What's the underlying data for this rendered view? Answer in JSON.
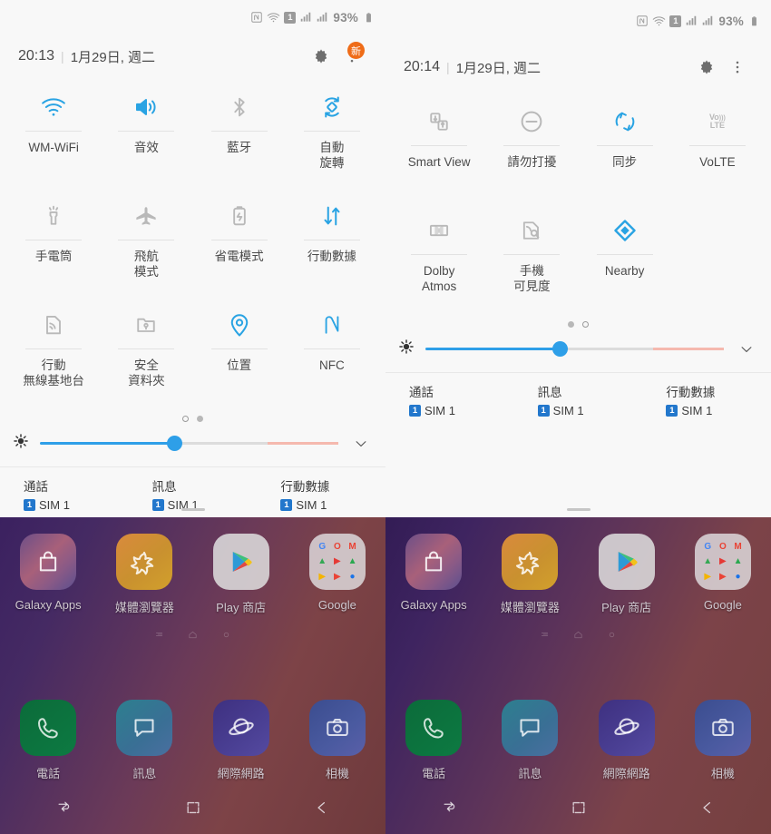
{
  "panels": [
    {
      "id": "left",
      "statusbar": {
        "icons": [
          "nfc-icon",
          "wifi-icon",
          "sim-badge",
          "signal-icon",
          "signal-icon"
        ],
        "sim_label": "1",
        "battery_percent": "93%"
      },
      "header": {
        "time": "20:13",
        "separator": "|",
        "date": "1月29日, 週二",
        "settings_icon": "gear-icon",
        "menu_icon": "more-vertical-icon",
        "badge": "新",
        "badge_color": "#ef6c18"
      },
      "tiles": [
        {
          "icon": "wifi-icon",
          "label": "WM-WiFi",
          "active": true
        },
        {
          "icon": "sound-icon",
          "label": "音效",
          "active": true
        },
        {
          "icon": "bluetooth-icon",
          "label": "藍牙",
          "active": false
        },
        {
          "icon": "auto-rotate-icon",
          "label": "自動\n旋轉",
          "active": true
        },
        {
          "icon": "flashlight-icon",
          "label": "手電筒",
          "active": false
        },
        {
          "icon": "airplane-icon",
          "label": "飛航\n模式",
          "active": false
        },
        {
          "icon": "power-save-icon",
          "label": "省電模式",
          "active": false
        },
        {
          "icon": "mobile-data-icon",
          "label": "行動數據",
          "active": true
        },
        {
          "icon": "hotspot-icon",
          "label": "行動\n無線基地台",
          "active": false
        },
        {
          "icon": "secure-folder-icon",
          "label": "安全\n資料夾",
          "active": false
        },
        {
          "icon": "location-icon",
          "label": "位置",
          "active": true
        },
        {
          "icon": "nfc-icon",
          "label": "NFC",
          "active": true
        }
      ],
      "page_dots": [
        true,
        false
      ],
      "brightness": {
        "icon": "brightness-icon",
        "value": 45,
        "expand_icon": "chevron-down-icon"
      },
      "sims": [
        {
          "title": "通話",
          "badge": "1",
          "name": "SIM 1"
        },
        {
          "title": "訊息",
          "badge": "1",
          "name": "SIM 1"
        },
        {
          "title": "行動數據",
          "badge": "1",
          "name": "SIM 1"
        }
      ],
      "home": {
        "apps": [
          {
            "icon": "galaxy-apps-icon",
            "label": "Galaxy Apps"
          },
          {
            "icon": "media-browser-icon",
            "label": "媒體瀏覽器"
          },
          {
            "icon": "play-store-icon",
            "label": "Play 商店"
          },
          {
            "icon": "google-folder-icon",
            "label": "Google"
          }
        ],
        "dock": [
          {
            "icon": "phone-icon",
            "label": "電話"
          },
          {
            "icon": "messages-icon",
            "label": "訊息"
          },
          {
            "icon": "internet-icon",
            "label": "網際網路"
          },
          {
            "icon": "camera-icon",
            "label": "相機"
          }
        ],
        "nav": [
          "recents-icon",
          "home-icon",
          "back-icon"
        ]
      }
    },
    {
      "id": "right",
      "statusbar": {
        "icons": [
          "nfc-icon",
          "wifi-icon",
          "sim-badge",
          "signal-icon",
          "signal-icon"
        ],
        "sim_label": "1",
        "battery_percent": "93%"
      },
      "header": {
        "time": "20:14",
        "separator": "|",
        "date": "1月29日, 週二",
        "settings_icon": "gear-icon",
        "menu_icon": "more-vertical-icon",
        "badge": "",
        "badge_color": "#ef6c18"
      },
      "tiles": [
        {
          "icon": "smart-view-icon",
          "label": "Smart View",
          "active": false
        },
        {
          "icon": "do-not-disturb-icon",
          "label": "請勿打擾",
          "active": false
        },
        {
          "icon": "sync-icon",
          "label": "同步",
          "active": true
        },
        {
          "icon": "volte-icon",
          "label": "VoLTE",
          "active": false
        },
        {
          "icon": "dolby-atmos-icon",
          "label": "Dolby\nAtmos",
          "active": false
        },
        {
          "icon": "phone-visibility-icon",
          "label": "手機\n可見度",
          "active": false
        },
        {
          "icon": "nearby-icon",
          "label": "Nearby",
          "active": true
        },
        {
          "icon": "",
          "label": "",
          "active": false
        }
      ],
      "page_dots": [
        false,
        true
      ],
      "brightness": {
        "icon": "brightness-icon",
        "value": 45,
        "expand_icon": "chevron-down-icon"
      },
      "sims": [
        {
          "title": "通話",
          "badge": "1",
          "name": "SIM 1"
        },
        {
          "title": "訊息",
          "badge": "1",
          "name": "SIM 1"
        },
        {
          "title": "行動數據",
          "badge": "1",
          "name": "SIM 1"
        }
      ],
      "home": {
        "apps": [
          {
            "icon": "galaxy-apps-icon",
            "label": "Galaxy Apps"
          },
          {
            "icon": "media-browser-icon",
            "label": "媒體瀏覽器"
          },
          {
            "icon": "play-store-icon",
            "label": "Play 商店"
          },
          {
            "icon": "google-folder-icon",
            "label": "Google"
          }
        ],
        "dock": [
          {
            "icon": "phone-icon",
            "label": "電話"
          },
          {
            "icon": "messages-icon",
            "label": "訊息"
          },
          {
            "icon": "internet-icon",
            "label": "網際網路"
          },
          {
            "icon": "camera-icon",
            "label": "相機"
          }
        ],
        "nav": [
          "recents-icon",
          "home-icon",
          "back-icon"
        ]
      }
    }
  ],
  "colors": {
    "active_tile": "#29a3e3",
    "inactive_tile": "#b9b9b9",
    "slider_fill": "#2e9fe8",
    "slider_tail": "#f5b9ae",
    "qs_background": "#f8f8f8",
    "badge_orange": "#ef6c18",
    "sim_blue": "#2277cc"
  }
}
